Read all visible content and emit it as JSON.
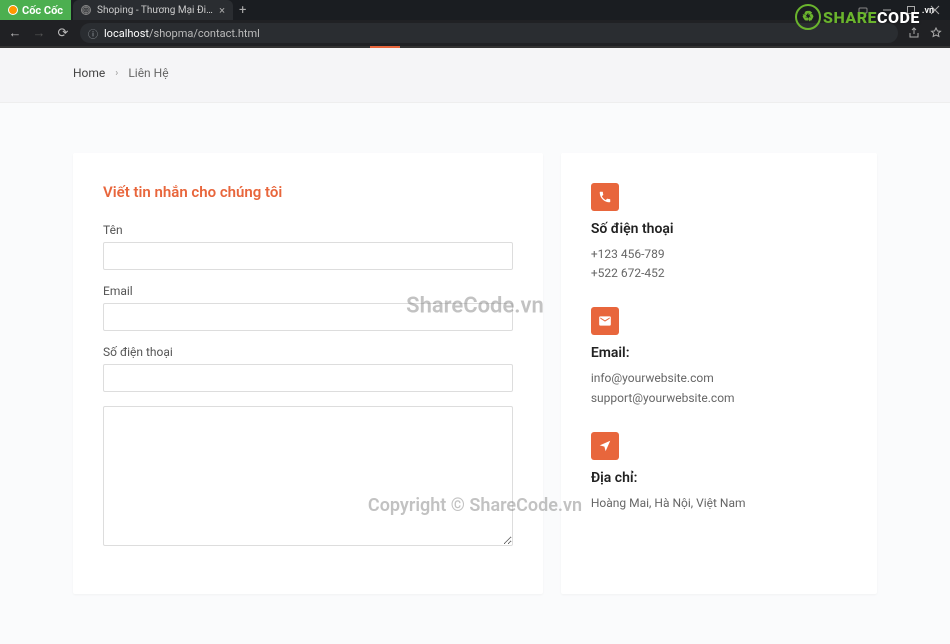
{
  "browser": {
    "logo": "Cốc Cốc",
    "tab_title": "Shoping - Thương Mại Điện",
    "url_host": "localhost",
    "url_path": "/shopma/contact.html"
  },
  "breadcrumb": {
    "home": "Home",
    "current": "Liên Hệ"
  },
  "form": {
    "title": "Viết tin nhắn cho chúng tôi",
    "name_label": "Tên",
    "email_label": "Email",
    "phone_label": "Số điện thoại"
  },
  "info": {
    "phone": {
      "title": "Số điện thoại",
      "line1": "+123 456-789",
      "line2": "+522 672-452"
    },
    "email": {
      "title": "Email:",
      "line1": "info@yourwebsite.com",
      "line2": "support@yourwebsite.com"
    },
    "address": {
      "title": "Địa chỉ:",
      "line1": "Hoàng Mai, Hà Nội, Việt Nam"
    }
  },
  "watermark": {
    "center": "ShareCode.vn",
    "bottom": "Copyright © ShareCode.vn",
    "logo_share": "SHARE",
    "logo_code": "CODE",
    "logo_vn": ".vn"
  }
}
